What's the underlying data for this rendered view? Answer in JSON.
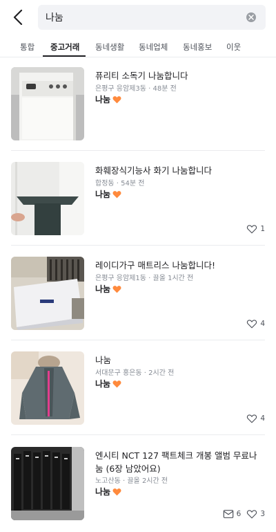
{
  "search": {
    "query": "나눔"
  },
  "tabs": [
    {
      "label": "통합"
    },
    {
      "label": "중고거래"
    },
    {
      "label": "동네생활"
    },
    {
      "label": "동네업체"
    },
    {
      "label": "동네홍보"
    },
    {
      "label": "이웃"
    }
  ],
  "active_tab": "중고거래",
  "items": [
    {
      "title": "퓨리티 소독기 나눔합니다",
      "location": "은평구 응암제3동",
      "time": "48분 전",
      "price": "나눔",
      "likes": ""
    },
    {
      "title": "화훼장식기능사 화기 나눔합니다",
      "location": "합정동",
      "time": "54분 전",
      "price": "나눔",
      "likes": "1"
    },
    {
      "title": "레이디가구 매트리스 나눔합니다!",
      "location": "은평구 응암제1동",
      "time": "끌올 1시간 전",
      "price": "나눔",
      "likes": "4"
    },
    {
      "title": "나눔",
      "location": "서대문구 홍은동",
      "time": "2시간 전",
      "price": "나눔",
      "likes": "4"
    },
    {
      "title": "엔시티 NCT 127 팩트체크 개봉 앨범 무료나눔 (6장 남았어요)",
      "location": "노고산동",
      "time": "끌올 2시간 전",
      "price": "나눔",
      "chats": "6",
      "likes": "3"
    }
  ],
  "colors": {
    "heart": "#ff8a3d",
    "accent": "#212124",
    "muted": "#868b94"
  },
  "icons": {
    "back": "back-arrow-icon",
    "clear": "clear-x-icon",
    "heart": "heart-icon",
    "like": "heart-outline-icon",
    "chat": "chat-icon"
  }
}
